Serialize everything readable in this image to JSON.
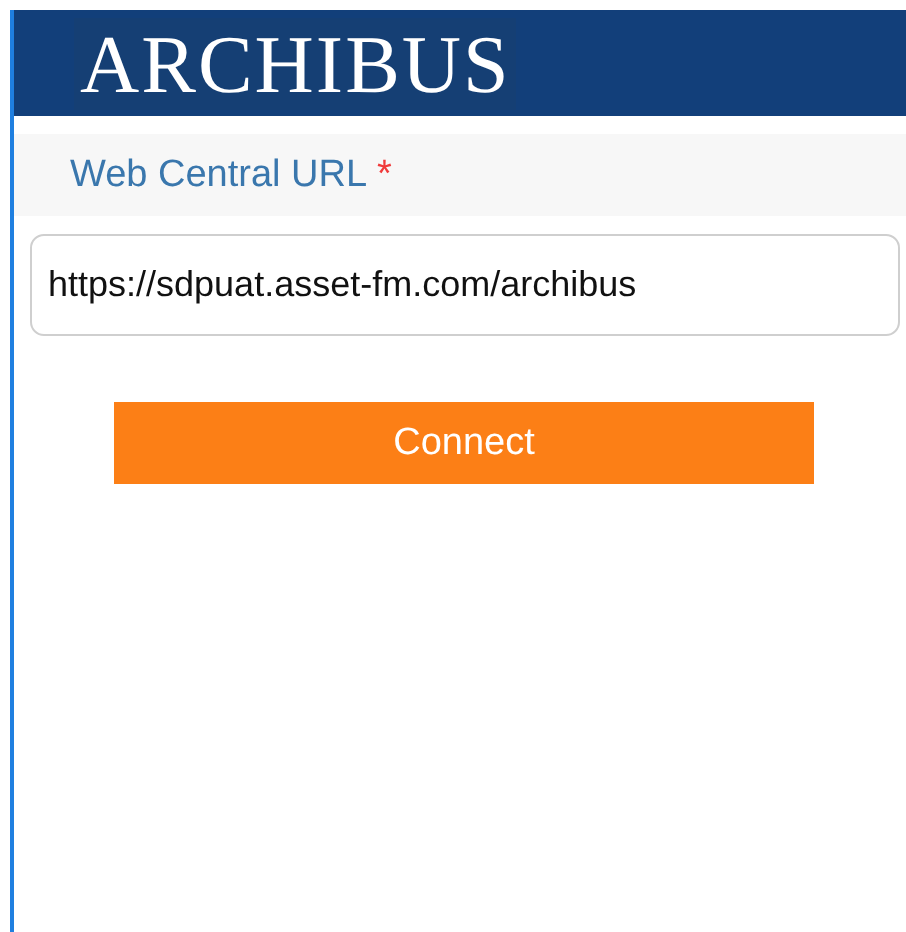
{
  "header": {
    "logo": "ARCHIBUS"
  },
  "form": {
    "field_label": "Web Central URL",
    "required_mark": "*",
    "url_value": "https://sdpuat.asset-fm.com/archibus",
    "button": "Connect"
  }
}
